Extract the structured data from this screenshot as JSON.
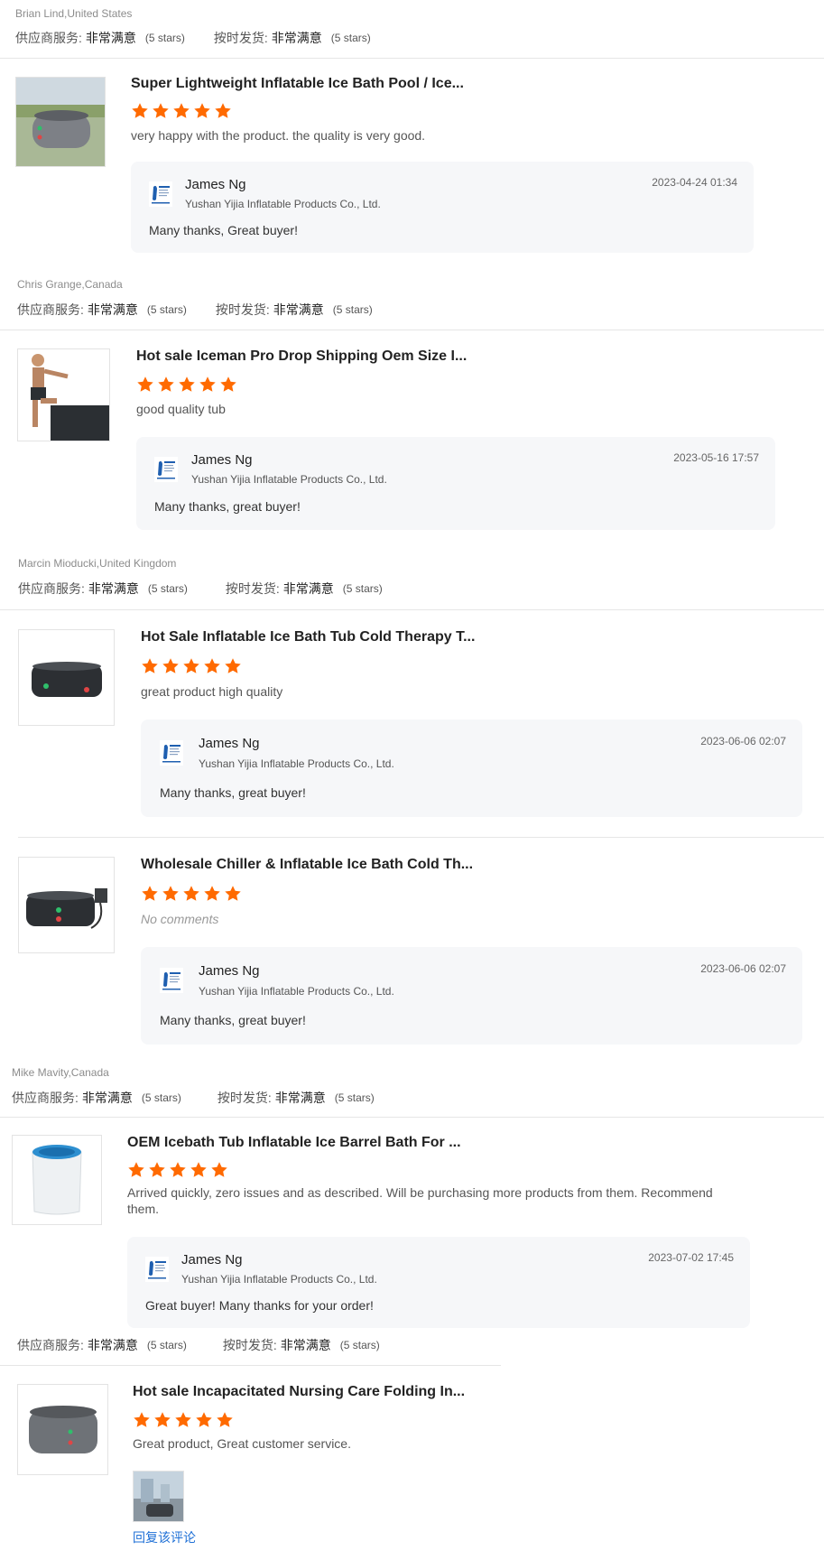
{
  "rating_labels": {
    "supplier_service": "供应商服务:",
    "on_time_shipping": "按时发货:",
    "value": "非常满意",
    "stars_text": "(5 stars)"
  },
  "reviews": [
    {
      "reviewer": "Brian Lind,United States",
      "product_title": "Super Lightweight Inflatable Ice Bath Pool / Ice...",
      "stars": 5,
      "comment": "very happy with the product. the quality is very good.",
      "reply": {
        "name": "James Ng",
        "company": "Yushan Yijia Inflatable Products Co., Ltd.",
        "date": "2023-04-24 01:34",
        "text": "Many thanks, Great buyer!"
      }
    },
    {
      "reviewer": "Chris Grange,Canada",
      "product_title": "Hot sale Iceman Pro Drop Shipping Oem Size I...",
      "stars": 5,
      "comment": "good quality tub",
      "reply": {
        "name": "James Ng",
        "company": "Yushan Yijia Inflatable Products Co., Ltd.",
        "date": "2023-05-16 17:57",
        "text": "Many thanks, great buyer!"
      }
    },
    {
      "reviewer": "Marcin Mioducki,United Kingdom",
      "product_title": "Hot Sale Inflatable Ice Bath Tub Cold Therapy T...",
      "stars": 5,
      "comment": "great product high quality",
      "reply": {
        "name": "James Ng",
        "company": "Yushan Yijia Inflatable Products Co., Ltd.",
        "date": "2023-06-06 02:07",
        "text": "Many thanks, great buyer!"
      }
    },
    {
      "reviewer": "",
      "product_title": "Wholesale Chiller & Inflatable Ice Bath Cold Th...",
      "stars": 5,
      "comment": "No comments",
      "reply": {
        "name": "James Ng",
        "company": "Yushan Yijia Inflatable Products Co., Ltd.",
        "date": "2023-06-06 02:07",
        "text": "Many thanks, great buyer!"
      }
    },
    {
      "reviewer": "Mike Mavity,Canada",
      "product_title": "OEM Icebath Tub Inflatable Ice Barrel Bath For ...",
      "stars": 5,
      "comment": "Arrived quickly, zero issues and as described.  Will be purchasing more products from them.  Recommend them.",
      "reply": {
        "name": "James Ng",
        "company": "Yushan Yijia Inflatable Products Co., Ltd.",
        "date": "2023-07-02 17:45",
        "text": "Great buyer! Many thanks for your order!"
      }
    },
    {
      "reviewer": "",
      "product_title": "Hot sale Incapacitated Nursing Care Folding In...",
      "stars": 5,
      "comment": "Great product, Great customer service.",
      "reply_link": "回复该评论"
    }
  ],
  "colors": {
    "star": "#ff6a00",
    "link": "#1d6fd6",
    "reply_bg": "#f6f7f9"
  },
  "icons": {
    "star": "star-icon",
    "logo": "company-logo-icon"
  }
}
